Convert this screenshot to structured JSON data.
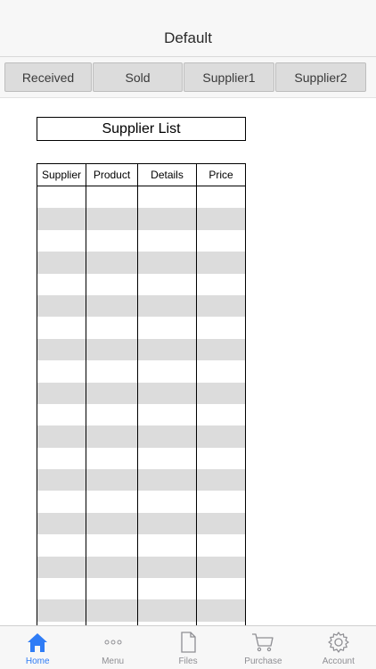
{
  "header": {
    "title": "Default"
  },
  "segments": [
    {
      "label": "Received"
    },
    {
      "label": "Sold"
    },
    {
      "label": "Supplier1"
    },
    {
      "label": "Supplier2"
    }
  ],
  "list": {
    "title": "Supplier List",
    "columns": [
      "Supplier",
      "Product",
      "Details",
      "Price"
    ]
  },
  "tabbar": {
    "items": [
      {
        "label": "Home",
        "icon": "home-icon",
        "active": true
      },
      {
        "label": "Menu",
        "icon": "dots-icon",
        "active": false
      },
      {
        "label": "Files",
        "icon": "file-icon",
        "active": false
      },
      {
        "label": "Purchase",
        "icon": "cart-icon",
        "active": false
      },
      {
        "label": "Account",
        "icon": "gear-icon",
        "active": false
      }
    ]
  },
  "colors": {
    "accent": "#2f7cf6",
    "inactive": "#8e8e93",
    "stripe": "#dcdcdc"
  }
}
